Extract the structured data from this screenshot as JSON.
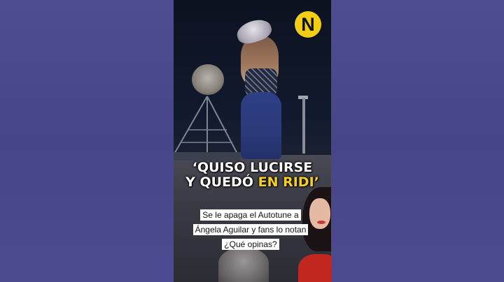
{
  "channel": {
    "logo_letter": "N",
    "logo_color": "#f2cf16"
  },
  "headline": {
    "line1": "‘QUISO LUCIRSE",
    "line2_prefix": "Y QUEDÓ ",
    "line2_highlight": "EN RIDI’",
    "highlight_color": "#f5d021"
  },
  "captions": {
    "line1": "Se le apaga el Autotune a",
    "line2": "Ángela Aguilar y fans lo notan",
    "line3": "¿Qué opinas?"
  }
}
